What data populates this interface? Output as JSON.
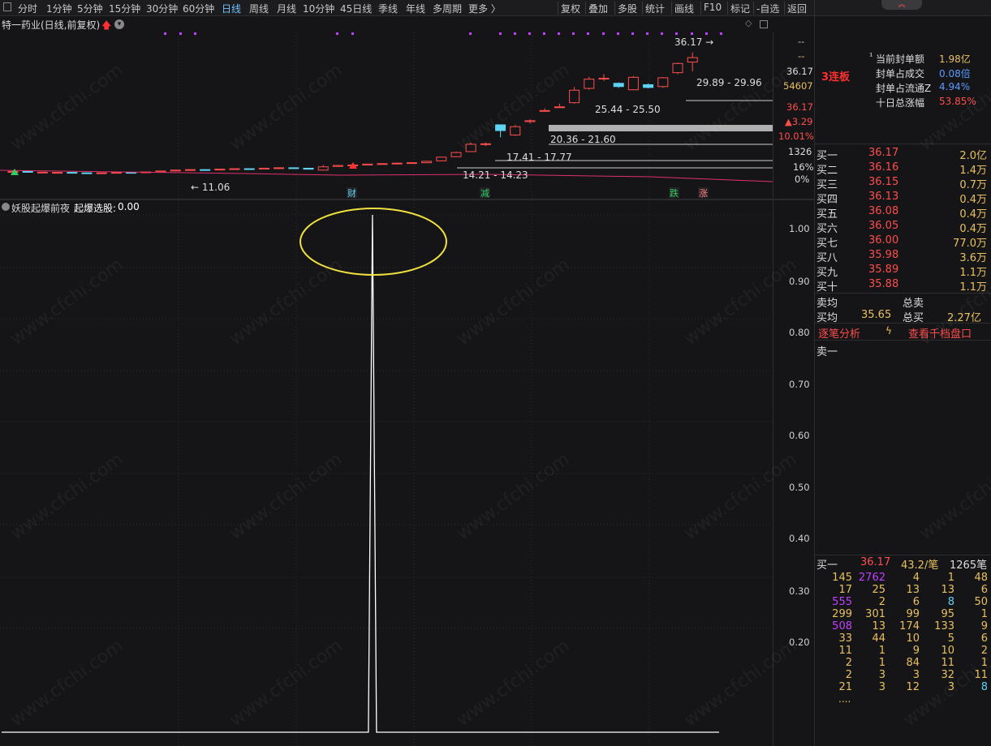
{
  "toolbar": {
    "periods": [
      "分时",
      "1分钟",
      "5分钟",
      "15分钟",
      "30分钟",
      "60分钟",
      "日线",
      "周线",
      "月线",
      "10分钟",
      "45日线",
      "季线",
      "年线",
      "多周期",
      "更多 〉"
    ],
    "active_period": "日线",
    "tools": [
      "复权",
      "叠加",
      "多股",
      "统计",
      "画线",
      "F10",
      "标记",
      "-自选",
      "返回"
    ]
  },
  "stock": {
    "title": "特一药业(日线,前复权)"
  },
  "chart": {
    "price_labels": {
      "p1": "36.17",
      "p2": "29.89 - 29.96",
      "p3": "25.44 - 25.50",
      "p4": "20.36 - 21.60",
      "p5": "17.41 - 17.77",
      "p6": "14.21 - 14.23",
      "low": "11.06"
    },
    "events": {
      "cai": "财",
      "jian": "减",
      "die": "跌",
      "zhang": "涨"
    }
  },
  "axis_top": {
    "dash1": "--",
    "dash2": "--",
    "price": "36.17",
    "vol": "54607",
    "last": "36.17",
    "change": "▲3.29",
    "pct": "10.01%",
    "v2": "1326",
    "p16": "16%",
    "p0": "0%"
  },
  "indicator": {
    "name": "妖股起爆前夜",
    "label": "起爆选股:",
    "value": "0.00"
  },
  "chart_data": {
    "type": "line",
    "series": [
      {
        "name": "起爆选股",
        "values": [
          0,
          0,
          0,
          0,
          0,
          0,
          0,
          0,
          0,
          0,
          0,
          0,
          0,
          0,
          0,
          0,
          0,
          0,
          0,
          0,
          0,
          0,
          0,
          0,
          0,
          0,
          0,
          0,
          0,
          0,
          0,
          0,
          0,
          0,
          0,
          0,
          0,
          0,
          0,
          0,
          0,
          0,
          0,
          0,
          0,
          0,
          0,
          0,
          0,
          0,
          0,
          0,
          0,
          0,
          0,
          0,
          0,
          0,
          0,
          0,
          0,
          0,
          0,
          0,
          0,
          0,
          0,
          0,
          0,
          0,
          0,
          0,
          0,
          0,
          0,
          0,
          0,
          0,
          0,
          0,
          0,
          0,
          0,
          0,
          0,
          0,
          0,
          0,
          0,
          0,
          0,
          0,
          1,
          0,
          0,
          0,
          0,
          0,
          0,
          0,
          0,
          0,
          0,
          0,
          0,
          0,
          0,
          0,
          0,
          0,
          0,
          0,
          0,
          0,
          0,
          0,
          0,
          0,
          0,
          0,
          0,
          0,
          0,
          0,
          0,
          0,
          0,
          0,
          0,
          0,
          0,
          0,
          0,
          0,
          0,
          0,
          0,
          0,
          0,
          0,
          0,
          0,
          0,
          0,
          0,
          0,
          0,
          0,
          0,
          0,
          0,
          0,
          0,
          0,
          0,
          0,
          0,
          0,
          0,
          0,
          0,
          0,
          0,
          0,
          0,
          0,
          0,
          0,
          0,
          0,
          0,
          0,
          0,
          0,
          0,
          0,
          0,
          0,
          0
        ]
      }
    ],
    "ylim": [
      0,
      1
    ],
    "yticks": [
      "1.00",
      "0.90",
      "0.80",
      "0.70",
      "0.60",
      "0.50",
      "0.40",
      "0.30",
      "0.20"
    ]
  },
  "watermark": "www.cfchi.com",
  "right_panel": {
    "badge": "3连板",
    "seal": [
      {
        "label": "当前封单额",
        "value": "1.98亿",
        "color": "#e8c060"
      },
      {
        "label": "封单占成交",
        "value": "0.08倍",
        "color": "#5b9bff"
      },
      {
        "label": "封单占流通Z",
        "value": "4.94%",
        "color": "#5b9bff"
      },
      {
        "label": "十日总涨幅",
        "value": "53.85%",
        "color": "#ff4d4d"
      }
    ],
    "bids": [
      {
        "label": "买一",
        "price": "36.17",
        "vol": "2.0亿"
      },
      {
        "label": "买二",
        "price": "36.16",
        "vol": "1.4万"
      },
      {
        "label": "买三",
        "price": "36.15",
        "vol": "0.7万"
      },
      {
        "label": "买四",
        "price": "36.13",
        "vol": "0.4万"
      },
      {
        "label": "买五",
        "price": "36.08",
        "vol": "0.4万"
      },
      {
        "label": "买六",
        "price": "36.05",
        "vol": "0.4万"
      },
      {
        "label": "买七",
        "price": "36.00",
        "vol": "77.0万"
      },
      {
        "label": "买八",
        "price": "35.98",
        "vol": "3.6万"
      },
      {
        "label": "买九",
        "price": "35.89",
        "vol": "1.1万"
      },
      {
        "label": "买十",
        "price": "35.88",
        "vol": "1.1万"
      }
    ],
    "avg": {
      "sell_avg": "卖均",
      "total_sell": "总卖",
      "buy_avg": "买均",
      "buy_avg_val": "35.65",
      "total_buy": "总买",
      "total_buy_val": "2.27亿"
    },
    "links": {
      "tick": "逐笔分析",
      "depth": "查看千档盘口"
    },
    "sell1": "卖一",
    "queue_head": {
      "label": "买一",
      "price": "36.17",
      "per": "43.2/笔",
      "count": "1265笔"
    },
    "queue": [
      [
        "145",
        "2762",
        "4",
        "1",
        "48"
      ],
      [
        "17",
        "25",
        "13",
        "13",
        "6"
      ],
      [
        "555",
        "2",
        "6",
        "8",
        "50"
      ],
      [
        "299",
        "301",
        "99",
        "95",
        "1"
      ],
      [
        "508",
        "13",
        "174",
        "133",
        "9"
      ],
      [
        "33",
        "44",
        "10",
        "5",
        "6"
      ],
      [
        "11",
        "1",
        "9",
        "10",
        "2"
      ],
      [
        "2",
        "1",
        "84",
        "11",
        "1"
      ],
      [
        "2",
        "3",
        "3",
        "32",
        "11"
      ],
      [
        "21",
        "3",
        "12",
        "3",
        "8"
      ]
    ],
    "more": "...."
  },
  "colors": {
    "up": "#ff4d4d",
    "down": "#5fd3f3",
    "ma": "#e0306b",
    "highlight": "#f0e040"
  }
}
